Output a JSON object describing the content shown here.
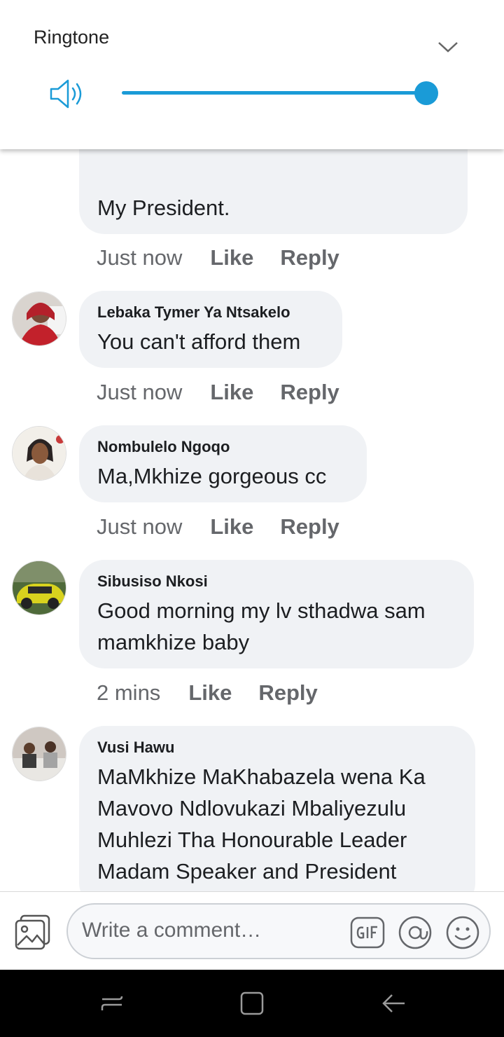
{
  "volume_panel": {
    "title": "Ringtone",
    "level_percent": 100,
    "accent": "#1a9bd7"
  },
  "comments": [
    {
      "author": "",
      "text": "My President.",
      "time": "Just now",
      "like": "Like",
      "reply": "Reply"
    },
    {
      "author": "Lebaka Tymer Ya Ntsakelo",
      "text": "You can't afford them",
      "time": "Just now",
      "like": "Like",
      "reply": "Reply"
    },
    {
      "author": "Nombulelo Ngoqo",
      "text": "Ma,Mkhize gorgeous cc",
      "time": "Just now",
      "like": "Like",
      "reply": "Reply"
    },
    {
      "author": "Sibusiso Nkosi",
      "text_lines": [
        "Good morning my lv sthadwa sam",
        "mamkhize baby"
      ],
      "time": "2 mins",
      "like": "Like",
      "reply": "Reply"
    },
    {
      "author": "Vusi Hawu",
      "text_lines": [
        "MaMkhize MaKhabazela wena Ka",
        "Mavovo Ndlovukazi Mbaliyezulu",
        "Muhlezi Tha Honourable Leader",
        "Madam Speaker and President"
      ]
    }
  ],
  "composer": {
    "placeholder": "Write a comment…",
    "icons": [
      "photo-icon",
      "gif-icon",
      "at-icon",
      "emoji-icon"
    ]
  },
  "navbar": {
    "icons": [
      "recent-apps-icon",
      "home-icon",
      "back-icon"
    ]
  }
}
